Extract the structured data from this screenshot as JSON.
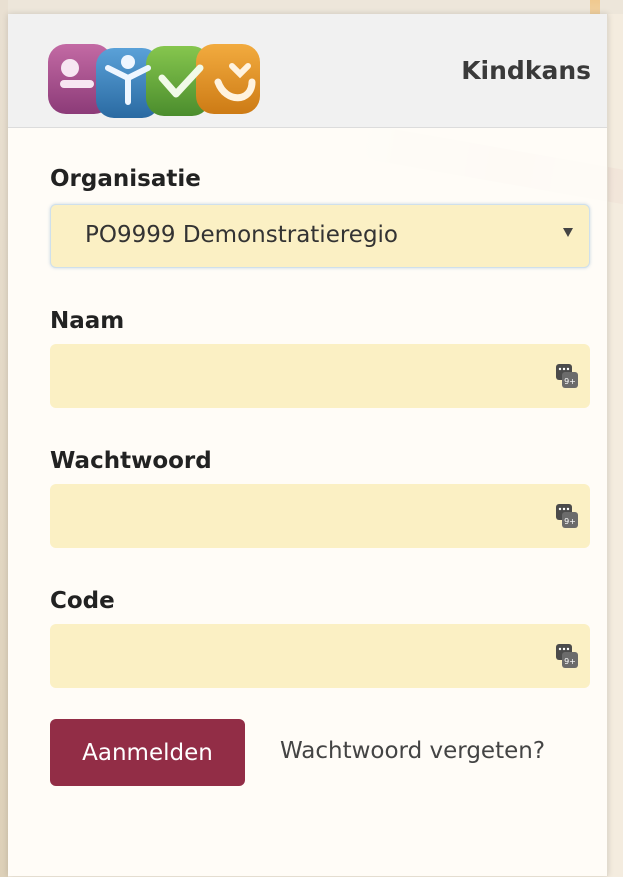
{
  "header": {
    "brand": "Kindkans",
    "logo_icon": "kindkans-logo-icon"
  },
  "form": {
    "organisatie": {
      "label": "Organisatie",
      "selected": "PO9999 Demonstratieregio"
    },
    "naam": {
      "label": "Naam",
      "value": ""
    },
    "wachtwoord": {
      "label": "Wachtwoord",
      "value": ""
    },
    "code": {
      "label": "Code",
      "value": ""
    }
  },
  "actions": {
    "login_label": "Aanmelden",
    "forgot_label": "Wachtwoord vergeten?"
  },
  "colors": {
    "primary_button": "#922d46",
    "field_background": "#fbf0c4",
    "header_background": "#f1f1f1"
  }
}
